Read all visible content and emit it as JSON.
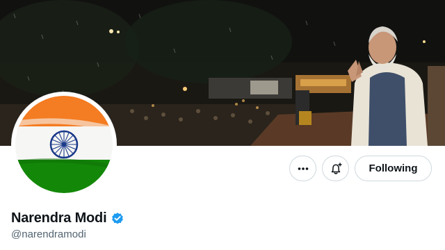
{
  "profile": {
    "display_name": "Narendra Modi",
    "handle": "@narendramodi",
    "verified": true
  },
  "actions": {
    "more_label": "More",
    "notify_label": "Turn on notifications",
    "follow_label": "Following"
  },
  "icons": {
    "more": "more-dots-icon",
    "notify": "bell-plus-icon",
    "verified": "verified-badge-icon"
  },
  "colors": {
    "verified_blue": "#1d9bf0",
    "text_primary": "#0f1419",
    "text_secondary": "#536471",
    "flag_saffron": "#f47c22",
    "flag_green": "#138808",
    "chakra_blue": "#1b3a8a"
  }
}
